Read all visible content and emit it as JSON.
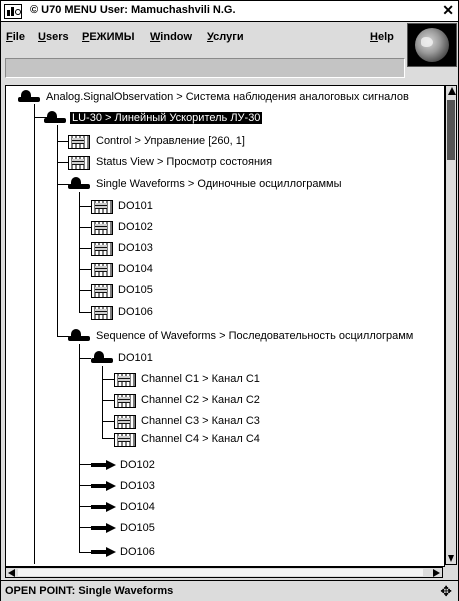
{
  "window": {
    "title": "© U70 MENU User: Mamuchashvili N.G.",
    "close_glyph": "✕"
  },
  "menu": {
    "file": "File",
    "users": "Users",
    "modes": "РЕЖИМЫ",
    "window": "Window",
    "services": "Услуги",
    "help": "Help"
  },
  "tree": {
    "root": "Analog.SignalObservation > Система наблюдения аналоговых сигналов",
    "lu30": "LU-30 > Линейный Ускоритель ЛУ-30",
    "control": "Control > Управление [260, 1]",
    "status_view": "Status View > Просмотр состояния",
    "single_waveforms": "Single Waveforms > Одиночные осциллограммы",
    "single_items": [
      "DO101",
      "DO102",
      "DO103",
      "DO104",
      "DO105",
      "DO106"
    ],
    "sequence": "Sequence of Waveforms > Последовательность осциллограмм",
    "seq_do101": "DO101",
    "channels": [
      "Channel C1 > Канал C1",
      "Channel C2 > Канал C2",
      "Channel C3 > Канал C3",
      "Channel C4 > Канал C4"
    ],
    "seq_items": [
      "DO102",
      "DO103",
      "DO104",
      "DO105",
      "DO106"
    ]
  },
  "status": {
    "text": "OPEN POINT: Single Waveforms"
  },
  "icons": {
    "module": "module-icon",
    "panel": "panel-icon",
    "arrow": "arrow-icon",
    "globe": "globe-icon"
  }
}
